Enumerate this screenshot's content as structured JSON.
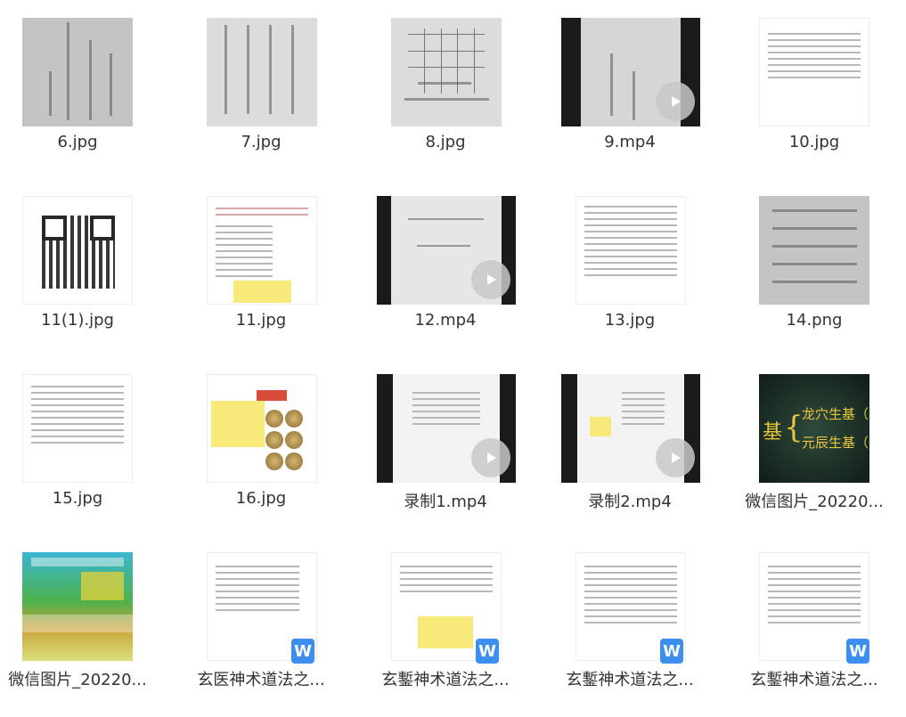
{
  "files": [
    {
      "name": "6.jpg",
      "type": "image"
    },
    {
      "name": "7.jpg",
      "type": "image"
    },
    {
      "name": "8.jpg",
      "type": "image"
    },
    {
      "name": "9.mp4",
      "type": "video"
    },
    {
      "name": "10.jpg",
      "type": "image"
    },
    {
      "name": "11(1).jpg",
      "type": "image"
    },
    {
      "name": "11.jpg",
      "type": "image"
    },
    {
      "name": "12.mp4",
      "type": "video"
    },
    {
      "name": "13.jpg",
      "type": "image"
    },
    {
      "name": "14.png",
      "type": "image"
    },
    {
      "name": "15.jpg",
      "type": "image"
    },
    {
      "name": "16.jpg",
      "type": "image"
    },
    {
      "name": "录制1.mp4",
      "type": "video"
    },
    {
      "name": "录制2.mp4",
      "type": "video"
    },
    {
      "name": "微信图片_20220...",
      "type": "image"
    },
    {
      "name": "微信图片_20220...",
      "type": "image"
    },
    {
      "name": "玄医神术道法之...",
      "type": "word"
    },
    {
      "name": "玄鏨神术道法之...",
      "type": "word"
    },
    {
      "name": "玄鏨神术道法之...",
      "type": "word"
    },
    {
      "name": "玄鏨神术道法之...",
      "type": "word"
    }
  ],
  "thumbnails": {
    "board_text_1": "龙穴生基（",
    "board_text_2": "元辰生基（",
    "board_prefix": "基"
  },
  "icons": {
    "play": "play-icon",
    "word": "word-icon",
    "word_letter": "W"
  },
  "colors": {
    "word_badge": "#3d8ef3",
    "label_text": "#333333"
  }
}
